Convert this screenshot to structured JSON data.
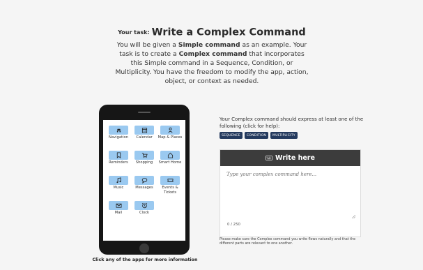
{
  "header": {
    "task_label": "Your task:",
    "task_title": "Write a Complex Command",
    "intro_1": "You will be given a ",
    "intro_b1": "Simple command",
    "intro_2": " as an example. Your task is to create a ",
    "intro_b2": "Complex command",
    "intro_3": " that incorporates this Simple command in a Sequence, Condition, or Multiplicity. You have the freedom to modify the app, action, object, or context as needed."
  },
  "phone": {
    "caption": "Click any of the apps for more information",
    "apps": [
      {
        "label": "Navigation",
        "icon": "car-icon"
      },
      {
        "label": "Calendar",
        "icon": "calendar-icon"
      },
      {
        "label": "Map & Places",
        "icon": "person-pin-icon"
      },
      {
        "label": "Reminders",
        "icon": "bookmark-icon"
      },
      {
        "label": "Shopping",
        "icon": "cart-icon"
      },
      {
        "label": "Smart Home",
        "icon": "house-icon"
      },
      {
        "label": "Music",
        "icon": "music-note-icon"
      },
      {
        "label": "Messages",
        "icon": "speech-bubble-icon"
      },
      {
        "label": "Events & Tickets",
        "icon": "ticket-icon"
      },
      {
        "label": "Mail",
        "icon": "envelope-icon"
      },
      {
        "label": "Clock",
        "icon": "alarm-clock-icon"
      }
    ]
  },
  "help": {
    "text": "Your Complex command should express at least one of the following (click for help):",
    "chips": [
      "SEQUENCE",
      "CONDITION",
      "MULTIPLICITY"
    ]
  },
  "editor": {
    "title": "Write here",
    "placeholder": "Type your complex command here...",
    "counter": "0 / 250"
  },
  "note": "Please make sure the Complex command you write flows naturally and that the different parts are relevant to one another.",
  "colors": {
    "app_tile": "#9ac9f0",
    "chip_bg": "#243a5e",
    "editor_header": "#3c3c3c",
    "phone_body": "#161616"
  }
}
